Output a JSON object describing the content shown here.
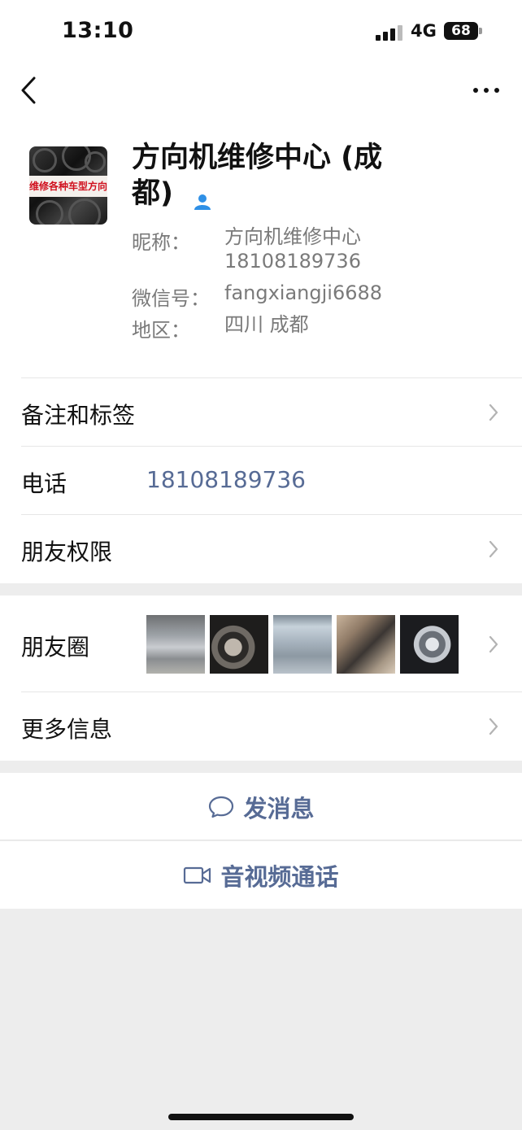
{
  "status_bar": {
    "time": "13:10",
    "network": "4G",
    "battery": "68"
  },
  "profile": {
    "display_name": "方向机维修中心 (成都)",
    "avatar_text": "维修各种车型方向机",
    "nickname_label": "昵称：",
    "nickname_value": "方向机维修中心 18108189736",
    "wechat_id_label": "微信号：",
    "wechat_id_value": "fangxiangji6688",
    "region_label": "地区：",
    "region_value": "四川 成都"
  },
  "cells": {
    "remark_label": "备注和标签",
    "phone_label": "电话",
    "phone_value": "18108189736",
    "permission_label": "朋友权限",
    "moments_label": "朋友圈",
    "more_info_label": "更多信息"
  },
  "actions": {
    "message_label": "发消息",
    "video_call_label": "音视频通话"
  },
  "colors": {
    "link": "#576b95",
    "background": "#ededed",
    "verify": "#2f90e6"
  }
}
